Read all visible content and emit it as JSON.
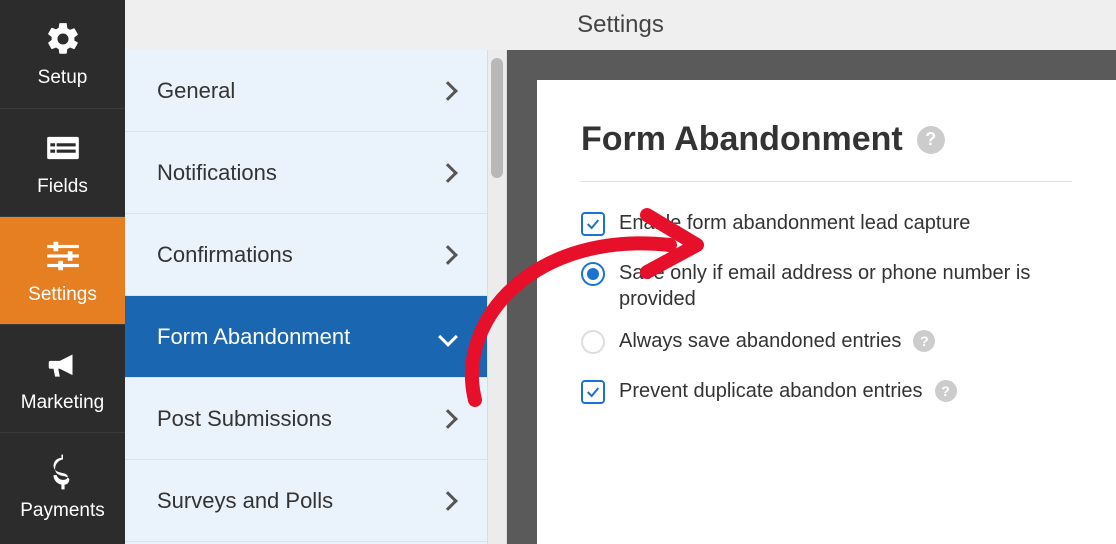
{
  "topbar": {
    "title": "Settings"
  },
  "rail": {
    "items": [
      {
        "label": "Setup"
      },
      {
        "label": "Fields"
      },
      {
        "label": "Settings"
      },
      {
        "label": "Marketing"
      },
      {
        "label": "Payments"
      }
    ]
  },
  "subnav": {
    "items": [
      {
        "label": "General"
      },
      {
        "label": "Notifications"
      },
      {
        "label": "Confirmations"
      },
      {
        "label": "Form Abandonment"
      },
      {
        "label": "Post Submissions"
      },
      {
        "label": "Surveys and Polls"
      }
    ]
  },
  "panel": {
    "heading": "Form Abandonment",
    "options": {
      "enable": "Enable form abandonment lead capture",
      "save_only": "Save only if email address or phone number is provided",
      "always": "Always save abandoned entries",
      "prevent": "Prevent duplicate abandon entries"
    }
  },
  "glyphs": {
    "help": "?"
  },
  "colors": {
    "accent": "#e67e22",
    "primary": "#1b66b1",
    "annotation": "#e6102a"
  }
}
